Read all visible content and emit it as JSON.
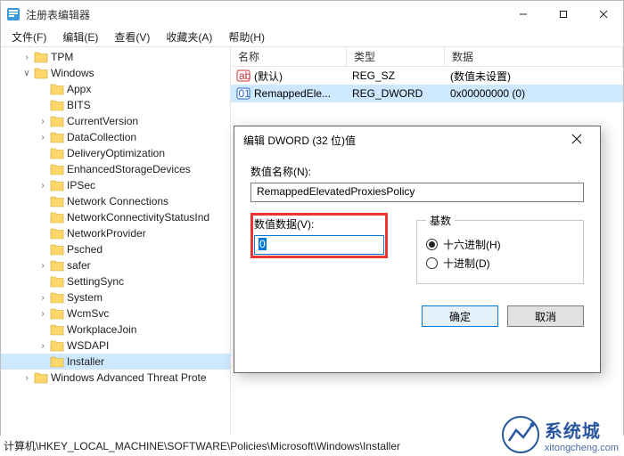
{
  "window": {
    "title": "注册表编辑器"
  },
  "menu": {
    "file": "文件(F)",
    "edit": "编辑(E)",
    "view": "查看(V)",
    "favorites": "收藏夹(A)",
    "help": "帮助(H)"
  },
  "tree": [
    {
      "indent": 1,
      "exp": ">",
      "label": "TPM"
    },
    {
      "indent": 1,
      "exp": "v",
      "label": "Windows"
    },
    {
      "indent": 2,
      "exp": "",
      "label": "Appx"
    },
    {
      "indent": 2,
      "exp": "",
      "label": "BITS"
    },
    {
      "indent": 2,
      "exp": ">",
      "label": "CurrentVersion"
    },
    {
      "indent": 2,
      "exp": ">",
      "label": "DataCollection"
    },
    {
      "indent": 2,
      "exp": "",
      "label": "DeliveryOptimization"
    },
    {
      "indent": 2,
      "exp": "",
      "label": "EnhancedStorageDevices"
    },
    {
      "indent": 2,
      "exp": ">",
      "label": "IPSec"
    },
    {
      "indent": 2,
      "exp": "",
      "label": "Network Connections"
    },
    {
      "indent": 2,
      "exp": "",
      "label": "NetworkConnectivityStatusInd"
    },
    {
      "indent": 2,
      "exp": "",
      "label": "NetworkProvider"
    },
    {
      "indent": 2,
      "exp": "",
      "label": "Psched"
    },
    {
      "indent": 2,
      "exp": ">",
      "label": "safer"
    },
    {
      "indent": 2,
      "exp": "",
      "label": "SettingSync"
    },
    {
      "indent": 2,
      "exp": ">",
      "label": "System"
    },
    {
      "indent": 2,
      "exp": ">",
      "label": "WcmSvc"
    },
    {
      "indent": 2,
      "exp": "",
      "label": "WorkplaceJoin"
    },
    {
      "indent": 2,
      "exp": ">",
      "label": "WSDAPI"
    },
    {
      "indent": 2,
      "exp": "",
      "label": "Installer",
      "selected": true
    },
    {
      "indent": 1,
      "exp": ">",
      "label": "Windows Advanced Threat Prote"
    }
  ],
  "list": {
    "headers": {
      "name": "名称",
      "type": "类型",
      "data": "数据"
    },
    "rows": [
      {
        "icon": "str",
        "name": "(默认)",
        "type": "REG_SZ",
        "data": "(数值未设置)",
        "selected": false
      },
      {
        "icon": "dword",
        "name": "RemappedEle...",
        "type": "REG_DWORD",
        "data": "0x00000000 (0)",
        "selected": true
      }
    ]
  },
  "dialog": {
    "title": "编辑 DWORD (32 位)值",
    "name_label": "数值名称(N):",
    "name_value": "RemappedElevatedProxiesPolicy",
    "value_label": "数值数据(V):",
    "value_data": "0",
    "base_label": "基数",
    "radio_hex": "十六进制(H)",
    "radio_dec": "十进制(D)",
    "ok": "确定",
    "cancel": "取消"
  },
  "status": "计算机\\HKEY_LOCAL_MACHINE\\SOFTWARE\\Policies\\Microsoft\\Windows\\Installer",
  "watermark": {
    "main": "系统城",
    "sub": "xitongcheng.com"
  }
}
